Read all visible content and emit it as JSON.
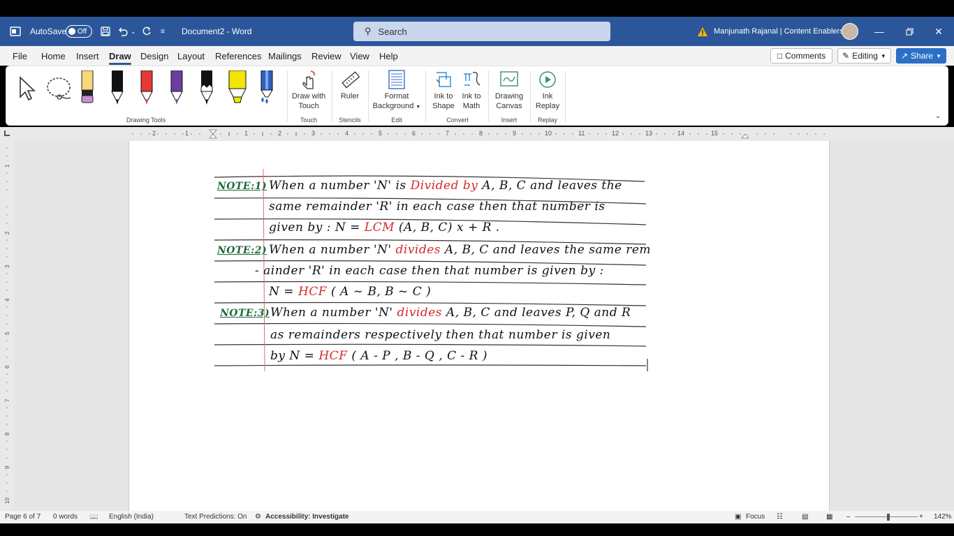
{
  "titlebar": {
    "autosave_label": "AutoSave",
    "autosave_state": "Off",
    "doc_title": "Document2  -  Word",
    "search_placeholder": "Search",
    "user_name": "Manjunath Rajanal | Content Enablers"
  },
  "menu": {
    "tabs": [
      "File",
      "Home",
      "Insert",
      "Draw",
      "Design",
      "Layout",
      "References",
      "Mailings",
      "Review",
      "View",
      "Help"
    ],
    "active_tab": "Draw",
    "comments_label": "Comments",
    "editing_label": "Editing",
    "share_label": "Share"
  },
  "ribbon": {
    "groups": {
      "drawing_tools": "Drawing Tools",
      "touch": "Touch",
      "stencils": "Stencils",
      "edit": "Edit",
      "convert": "Convert",
      "insert": "Insert",
      "replay": "Replay"
    },
    "commands": {
      "draw_with_touch_1": "Draw with",
      "draw_with_touch_2": "Touch",
      "ruler": "Ruler",
      "format_bg_1": "Format",
      "format_bg_2": "Background",
      "ink_to_shape_1": "Ink to",
      "ink_to_shape_2": "Shape",
      "ink_to_math_1": "Ink to",
      "ink_to_math_2": "Math",
      "drawing_canvas_1": "Drawing",
      "drawing_canvas_2": "Canvas",
      "ink_replay_1": "Ink",
      "ink_replay_2": "Replay"
    },
    "pens": [
      {
        "name": "pencil-yellow",
        "color": "#f6d77a",
        "tip": "#c98fd0"
      },
      {
        "name": "pen-black",
        "color": "#111111"
      },
      {
        "name": "pen-red",
        "color": "#e53935"
      },
      {
        "name": "pen-purple",
        "color": "#6a3fa0"
      },
      {
        "name": "pen-black-2",
        "color": "#111111"
      },
      {
        "name": "highlighter-yellow",
        "color": "#f2e600"
      },
      {
        "name": "pen-galaxy",
        "color": "#2f5fbf"
      }
    ]
  },
  "ruler": {
    "numbers": [
      "2",
      "1",
      "1",
      "2",
      "3",
      "4",
      "5",
      "6",
      "7",
      "8",
      "9",
      "10",
      "11",
      "12",
      "13",
      "14",
      "15"
    ]
  },
  "notes": {
    "n1_label": "NOTE:1)",
    "n1_line1_a": "When a number 'N' is ",
    "n1_line1_red": "Divided by",
    "n1_line1_b": " A, B, C and leaves the",
    "n1_line2": "same remainder 'R' in each case then that number is",
    "n1_line3_a": "given by : N = ",
    "n1_line3_red": "LCM",
    "n1_line3_b": " (A, B, C) x + R .",
    "n2_label": "NOTE:2)",
    "n2_line1_a": "When a number 'N' ",
    "n2_line1_red": "divides",
    "n2_line1_b": " A, B, C and leaves the same rem",
    "n2_line2": "- ainder 'R' in each case then that number is given by :",
    "n2_line3_a": "N = ",
    "n2_line3_red": "HCF",
    "n2_line3_b": " ( A ~ B, B ~ C )",
    "n3_label": "NOTE:3)",
    "n3_line1_a": "When a number 'N' ",
    "n3_line1_red": "divides",
    "n3_line1_b": " A, B, C and leaves P, Q and R",
    "n3_line2": "as remainders respectively then that number is given",
    "n3_line3_a": "by  N = ",
    "n3_line3_red": "HCF",
    "n3_line3_b": " ( A - P , B - Q , C - R )"
  },
  "status": {
    "page": "Page 6 of 7",
    "words": "0 words",
    "language": "English (India)",
    "predictions": "Text Predictions: On",
    "accessibility": "Accessibility: Investigate",
    "focus": "Focus",
    "zoom": "142%"
  },
  "colors": {
    "title_blue": "#2b579a",
    "ink_red": "#d42a2a",
    "note_green": "#1c6b3a"
  }
}
